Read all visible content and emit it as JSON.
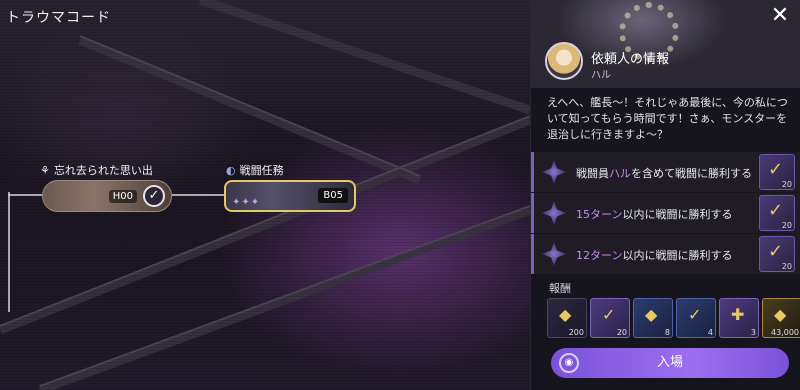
{
  "screen_title": "トラウマコード",
  "nodes": {
    "forgotten": {
      "label": "忘れ去られた思い出",
      "code": "H00"
    },
    "battle": {
      "label": "戦闘任務",
      "code": "B05",
      "stars": "✦✦✦"
    }
  },
  "panel": {
    "client_title": "依頼人の情報",
    "client_name": "ハル",
    "dialogue": "えへへ、艦長〜！それじゃあ最後に、今の私について知ってもらう時間です！さぁ、モンスターを退治しに行きますよ〜？",
    "missions": [
      {
        "pre": "戦闘員",
        "highlight": "ハル",
        "post": "を含めて戦闘に勝利する",
        "reward_qty": "20"
      },
      {
        "pre": "",
        "highlight": "15ターン",
        "post": "以内に戦闘に勝利する",
        "reward_qty": "20"
      },
      {
        "pre": "",
        "highlight": "12ターン",
        "post": "以内に戦闘に勝利する",
        "reward_qty": "20"
      }
    ],
    "rewards_label": "報酬",
    "rewards": [
      {
        "qty": "200",
        "style": "r-dark"
      },
      {
        "qty": "20",
        "style": "r-purple"
      },
      {
        "qty": "8",
        "style": "r-blue"
      },
      {
        "qty": "4",
        "style": "r-blue"
      },
      {
        "qty": "3",
        "style": "r-purple"
      },
      {
        "qty": "43,000",
        "style": "r-gold"
      }
    ],
    "enter_label": "入場"
  },
  "colors": {
    "accent": "#9c6ff0",
    "highlight": "#c88cf2",
    "gold": "#e8c864"
  }
}
